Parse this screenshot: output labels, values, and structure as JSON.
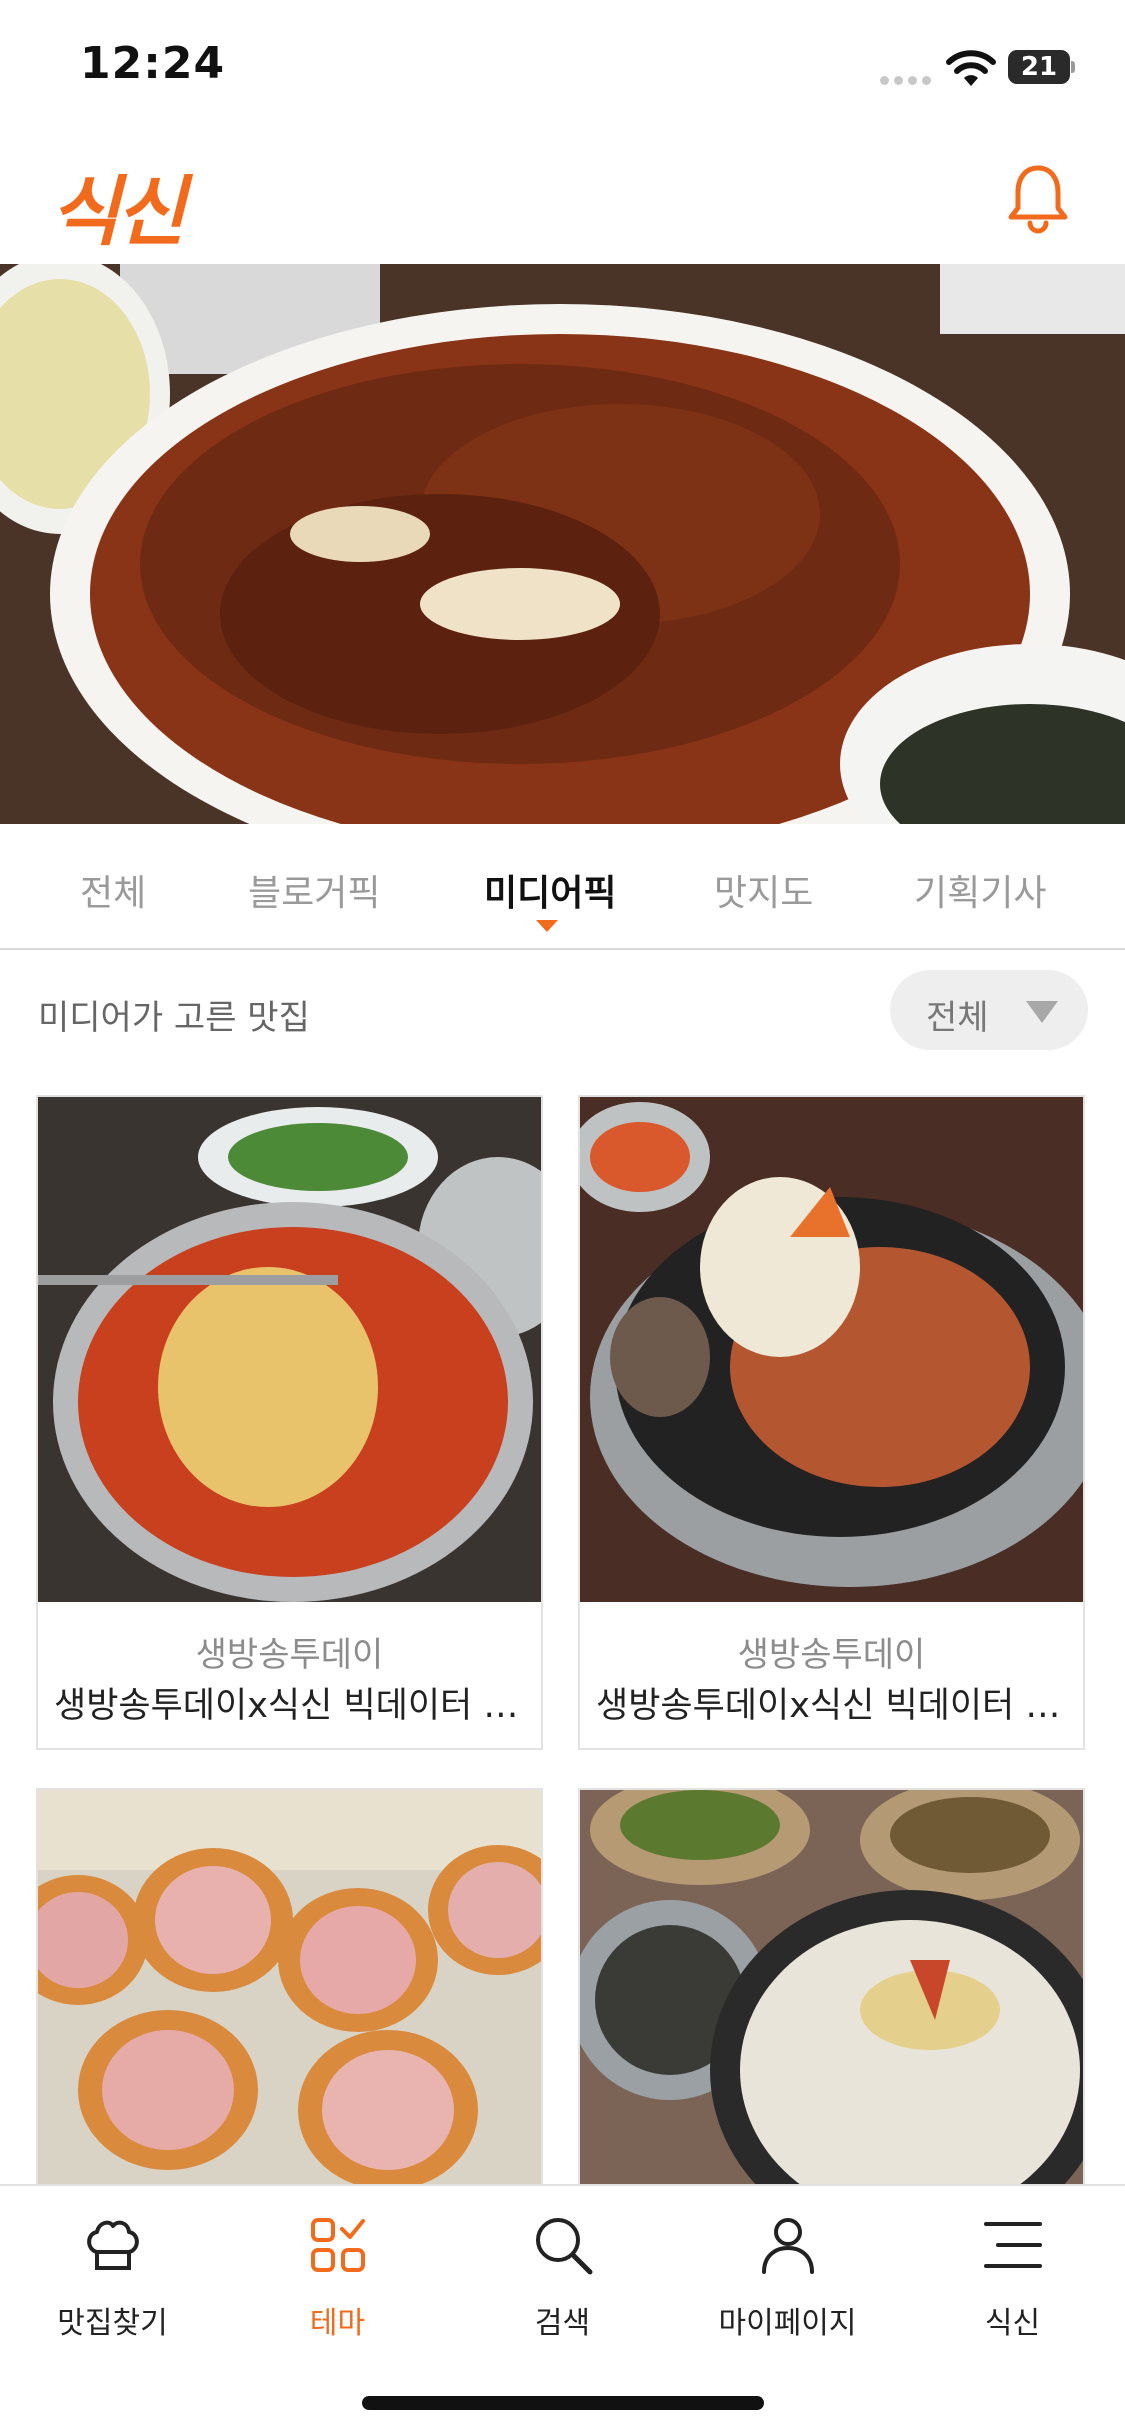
{
  "status_bar": {
    "time": "12:24",
    "battery": "21"
  },
  "header": {
    "logo": "식신",
    "bell_icon": "bell-icon"
  },
  "hero": {
    "slides": 5,
    "active_slide": 1
  },
  "tabs": [
    {
      "label": "전체"
    },
    {
      "label": "블로거픽"
    },
    {
      "label": "미디어픽",
      "active": true
    },
    {
      "label": "맛지도"
    },
    {
      "label": "기획기사"
    }
  ],
  "section": {
    "title": "미디어가 고른 맛집",
    "filter_value": "전체"
  },
  "cards": [
    {
      "source": "생방송투데이",
      "title": "생방송투데이x식신 빅데이터 맛집"
    },
    {
      "source": "생방송투데이",
      "title": "생방송투데이x식신 빅데이터 맛집"
    },
    {
      "source": "",
      "title": ""
    },
    {
      "source": "",
      "title": ""
    }
  ],
  "bottom_nav": [
    {
      "label": "맛집찾기",
      "icon": "chef-hat-icon"
    },
    {
      "label": "테마",
      "icon": "theme-grid-icon",
      "active": true
    },
    {
      "label": "검색",
      "icon": "search-icon"
    },
    {
      "label": "마이페이지",
      "icon": "person-icon"
    },
    {
      "label": "식신",
      "icon": "menu-icon"
    }
  ],
  "colors": {
    "accent": "#f26b1d",
    "dot_active": "#f5a11b"
  }
}
